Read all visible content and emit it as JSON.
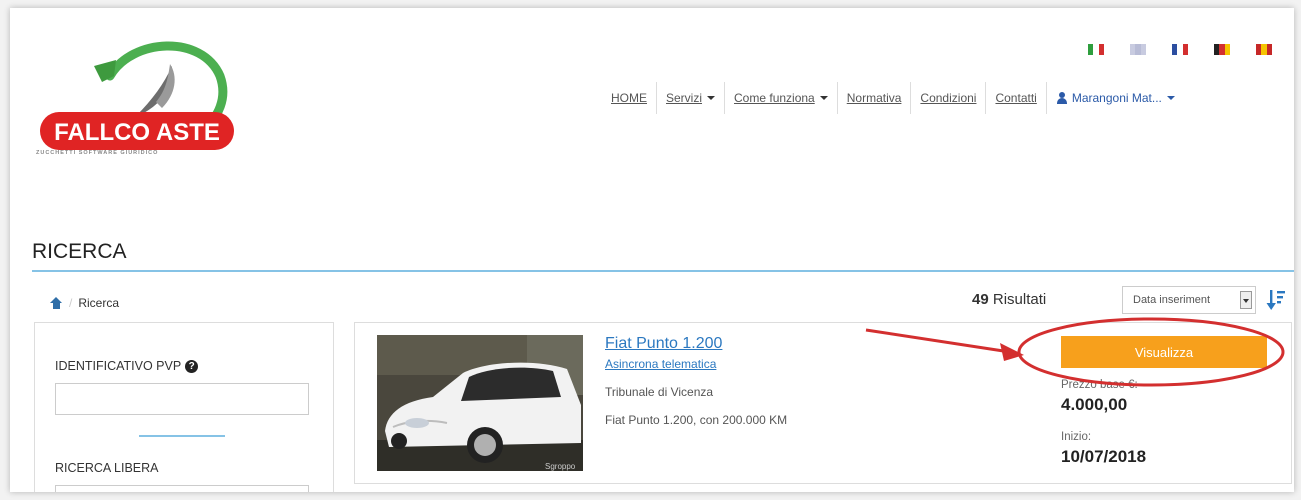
{
  "header": {
    "logo_text": "FALLCO ASTE",
    "logo_subtitle": "ZUCCHETTI SOFTWARE GIURIDICO",
    "flags": [
      {
        "name": "italian-flag",
        "colors": [
          "#2e9e3e",
          "#ffffff",
          "#d32f2f"
        ]
      },
      {
        "name": "english-flag",
        "colors": [
          "#c8cbe0",
          "#b8bcd6",
          "#c8cbe0"
        ]
      },
      {
        "name": "french-flag",
        "colors": [
          "#2c4ea0",
          "#ffffff",
          "#d32f2f"
        ]
      },
      {
        "name": "german-flag",
        "colors": [
          "#222222",
          "#d32f2f",
          "#f5c400"
        ]
      },
      {
        "name": "spanish-flag",
        "colors": [
          "#c62828",
          "#f5c400",
          "#c62828"
        ]
      }
    ]
  },
  "nav": {
    "home": "HOME",
    "servizi": "Servizi",
    "come_funziona": "Come funziona",
    "normativa": "Normativa",
    "condizioni": "Condizioni",
    "contatti": "Contatti",
    "user": "Marangoni Mat..."
  },
  "page": {
    "title": "RICERCA",
    "breadcrumb_sep": "/",
    "breadcrumb": "Ricerca",
    "results_count": "49",
    "results_label": "Risultati",
    "sort_value": "Data inseriment"
  },
  "filters": {
    "pvp_label": "IDENTIFICATIVO PVP",
    "pvp_help_icon": "?",
    "free_label": "RICERCA LIBERA"
  },
  "result": {
    "title": "Fiat Punto 1.200",
    "type": "Asincrona telematica",
    "court": "Tribunale di Vicenza",
    "description": "Fiat Punto 1.200, con 200.000 KM",
    "button": "Visualizza",
    "price_label": "Prezzo base €:",
    "price": "4.000,00",
    "start_label": "Inizio:",
    "start_date": "10/07/2018",
    "photo_caption": "Sgroppo"
  },
  "colors": {
    "accent": "#f7a01c",
    "link": "#2b78c0",
    "annotation": "#d32f2f",
    "rule": "#86c3e6"
  }
}
